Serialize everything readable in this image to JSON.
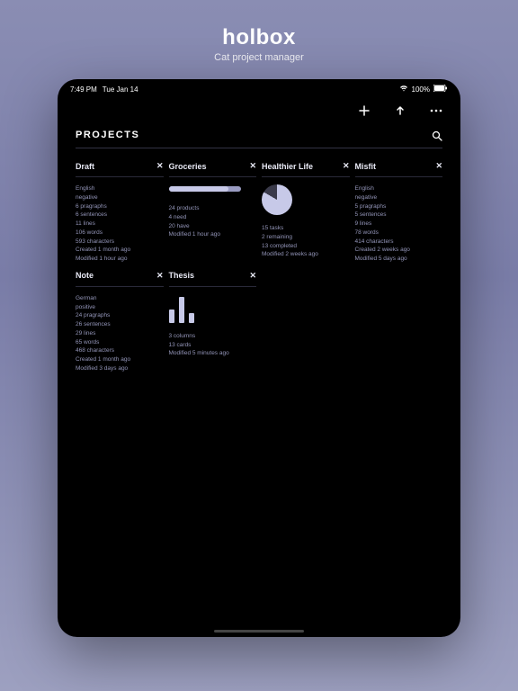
{
  "promo": {
    "title": "holbox",
    "subtitle": "Cat project manager"
  },
  "status": {
    "time": "7:49 PM",
    "date": "Tue Jan 14",
    "battery": "100%"
  },
  "section": {
    "title": "PROJECTS"
  },
  "cards": [
    {
      "title": "Draft",
      "close": "✕",
      "lines": [
        "English",
        "negative",
        "6 pragraphs",
        "6 sentences",
        "11 lines",
        "106 words",
        "593 characters",
        "Created 1 month ago",
        "Modified 1 hour ago"
      ]
    },
    {
      "title": "Groceries",
      "close": "✕",
      "progress": 0.83,
      "lines": [
        "24 products",
        "4 need",
        "20 have",
        "Modified 1 hour ago"
      ]
    },
    {
      "title": "Healthier Life",
      "close": "✕",
      "pie": true,
      "lines": [
        "15 tasks",
        "2 remaining",
        "13 completed",
        "Modified 2 weeks ago"
      ]
    },
    {
      "title": "Misfit",
      "close": "✕",
      "lines": [
        "English",
        "negative",
        "5 pragraphs",
        "5 sentences",
        "9 lines",
        "78 words",
        "414 characters",
        "Created 2 weeks ago",
        "Modified 5 days ago"
      ]
    },
    {
      "title": "Note",
      "close": "✕",
      "lines": [
        "German",
        "positive",
        "24 pragraphs",
        "26 sentences",
        "29 lines",
        "65 words",
        "468 characters",
        "Created 1 month ago",
        "Modified 3 days ago"
      ]
    },
    {
      "title": "Thesis",
      "close": "✕",
      "bars": [
        0.45,
        0.9,
        0.35
      ],
      "lines": [
        "3 columns",
        "13 cards",
        "Modified 5 minutes ago"
      ]
    }
  ]
}
